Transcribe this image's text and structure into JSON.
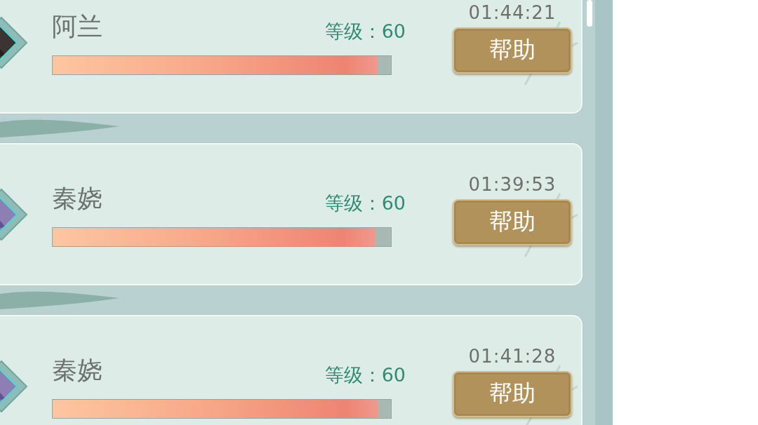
{
  "entries": [
    {
      "name": "阿兰",
      "level_text": "等级：60",
      "progress": {
        "level": 0.96
      },
      "timer": "01:44:21",
      "button": "帮助"
    },
    {
      "name": "秦娆",
      "level_text": "等级：60",
      "progress": {
        "level": 0.955
      },
      "timer": "01:39:53",
      "button": "帮助"
    },
    {
      "name": "秦娆",
      "level_text": "等级：60",
      "progress": {
        "level": 0.963
      },
      "timer": "01:41:28",
      "button": "帮助"
    }
  ]
}
